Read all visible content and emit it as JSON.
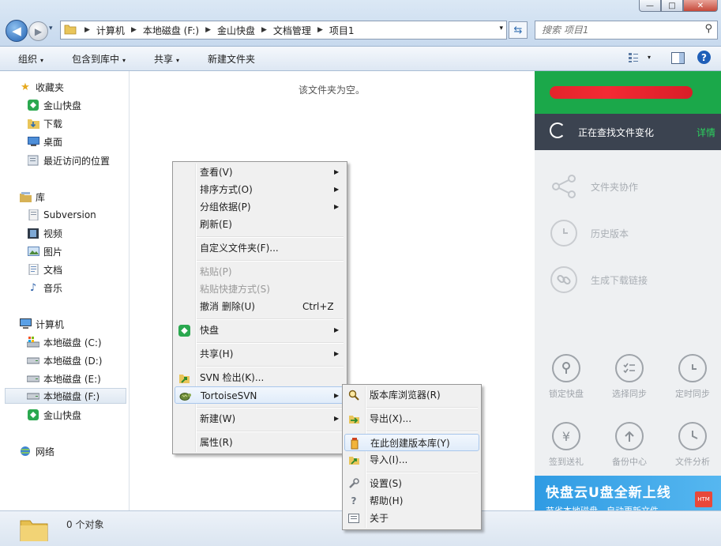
{
  "window": {
    "minimize": "—",
    "maximize": "□",
    "close": "✕"
  },
  "nav": {
    "back": "◀",
    "forward": "▶",
    "dropdown": "▾"
  },
  "address": {
    "breadcrumb": [
      "计算机",
      "本地磁盘 (F:)",
      "金山快盘",
      "文档管理",
      "项目1"
    ],
    "dropdown": "▾",
    "refresh": "⇆"
  },
  "search": {
    "placeholder": "搜索 项目1",
    "icon": "search-icon"
  },
  "toolbar": {
    "organize": "组织",
    "include_library": "包含到库中",
    "share": "共享",
    "new_folder": "新建文件夹",
    "arrow": "▾",
    "help": "?"
  },
  "sidebar": {
    "favorites": {
      "label": "收藏夹",
      "items": [
        "金山快盘",
        "下载",
        "桌面",
        "最近访问的位置"
      ]
    },
    "libraries": {
      "label": "库",
      "items": [
        "Subversion",
        "视频",
        "图片",
        "文档",
        "音乐"
      ]
    },
    "computer": {
      "label": "计算机",
      "items": [
        "本地磁盘 (C:)",
        "本地磁盘 (D:)",
        "本地磁盘 (E:)",
        "本地磁盘 (F:)",
        "金山快盘"
      ]
    },
    "network": {
      "label": "网络"
    }
  },
  "content": {
    "empty_text": "该文件夹为空。"
  },
  "kuaipan": {
    "status": "正在查找文件变化",
    "details": "详情",
    "features": [
      "文件夹协作",
      "历史版本",
      "生成下载链接"
    ],
    "grid": [
      "锁定快盘",
      "选择同步",
      "定时同步",
      "签到送礼",
      "备份中心",
      "文件分析"
    ],
    "banner_title": "快盘云U盘全新上线",
    "banner_sub": "节省本地磁盘，自动更新文件",
    "banner_badge": "HTM"
  },
  "status_bar": {
    "count": "0 个对象"
  },
  "context_menu": {
    "items": [
      {
        "label": "查看(V)",
        "submenu": true
      },
      {
        "label": "排序方式(O)",
        "submenu": true
      },
      {
        "label": "分组依据(P)",
        "submenu": true
      },
      {
        "label": "刷新(E)"
      },
      {
        "label": "自定义文件夹(F)..."
      },
      {
        "label": "粘贴(P)",
        "disabled": true
      },
      {
        "label": "粘贴快捷方式(S)",
        "disabled": true
      },
      {
        "label": "撤消 删除(U)",
        "shortcut": "Ctrl+Z"
      },
      {
        "label": "快盘",
        "submenu": true
      },
      {
        "label": "共享(H)",
        "submenu": true
      },
      {
        "label": "SVN 检出(K)..."
      },
      {
        "label": "TortoiseSVN",
        "submenu": true
      },
      {
        "label": "新建(W)",
        "submenu": true
      },
      {
        "label": "属性(R)"
      }
    ],
    "arrow": "▶"
  },
  "svn_menu": {
    "items": [
      "版本库浏览器(R)",
      "导出(X)...",
      "在此创建版本库(Y)",
      "导入(I)...",
      "设置(S)",
      "帮助(H)",
      "关于"
    ]
  }
}
